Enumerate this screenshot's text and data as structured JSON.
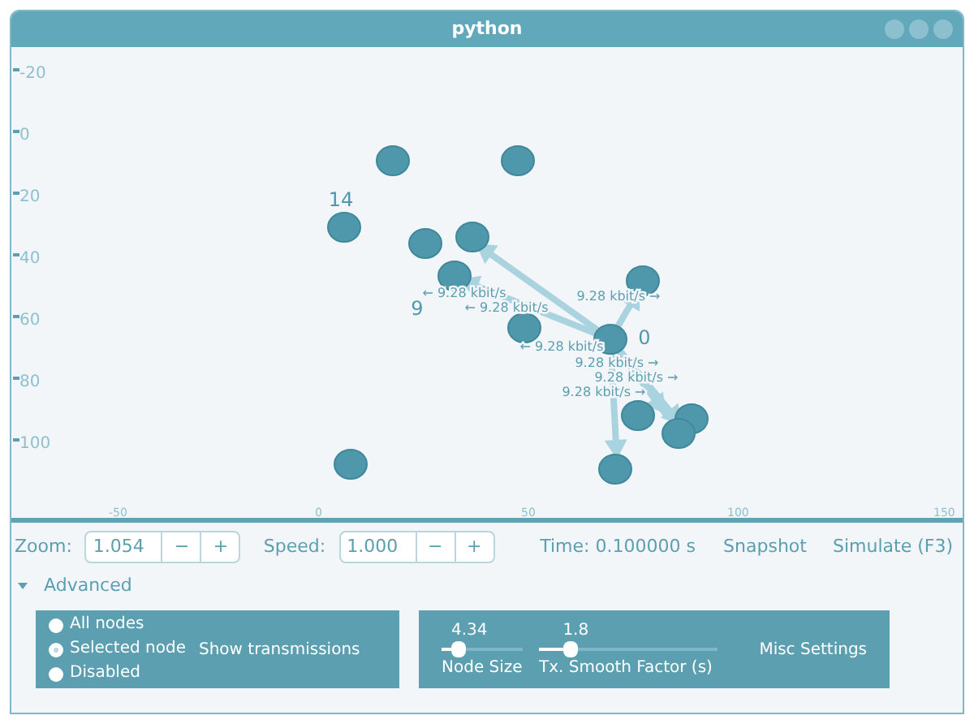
{
  "window": {
    "title": "python"
  },
  "canvas": {
    "y_ticks": [
      "-20",
      "0",
      "20",
      "40",
      "60",
      "80",
      "100"
    ],
    "x_ticks": [
      "-50",
      "0",
      "50",
      "100",
      "150"
    ],
    "nodes": [
      {
        "kind": "node"
      },
      {
        "kind": "node"
      },
      {
        "kind": "node",
        "label": "14"
      },
      {
        "kind": "node"
      },
      {
        "kind": "node"
      },
      {
        "kind": "node",
        "label": "9"
      },
      {
        "kind": "node"
      },
      {
        "kind": "node",
        "label": "0"
      },
      {
        "kind": "node"
      },
      {
        "kind": "node"
      },
      {
        "kind": "node"
      },
      {
        "kind": "node"
      },
      {
        "kind": "node"
      },
      {
        "kind": "node"
      }
    ],
    "transmissions": [
      {
        "text": "← 9.28 kbit/s"
      },
      {
        "text": "9.28 kbit/s →"
      },
      {
        "text": "← 9.28 kbit/s"
      },
      {
        "text": "← 9.28 kbit/s"
      },
      {
        "text": "9.28 kbit/s →"
      },
      {
        "text": "9.28 kbit/s →"
      },
      {
        "text": "9.28 kbit/s →"
      }
    ]
  },
  "toolbar": {
    "zoom": {
      "label": "Zoom:",
      "value": "1.054",
      "minus": "−",
      "plus": "+"
    },
    "speed": {
      "label": "Speed:",
      "value": "1.000",
      "minus": "−",
      "plus": "+"
    },
    "time": "Time: 0.100000 s",
    "buttons": [
      "Snapshot",
      "Simulate (F3)"
    ]
  },
  "advanced": {
    "label": "Advanced",
    "expanded": true,
    "transmissions": {
      "title": "Show transmissions",
      "options": [
        {
          "label": "All nodes",
          "selected": false
        },
        {
          "label": "Selected node",
          "selected": true
        },
        {
          "label": "Disabled",
          "selected": false
        }
      ]
    },
    "misc": {
      "title": "Misc Settings",
      "sliders": [
        {
          "name": "Node Size",
          "reading": "4.34",
          "level": 0.2
        },
        {
          "name": "Tx. Smooth Factor (s)",
          "reading": "1.8",
          "level": 0.17
        }
      ]
    }
  }
}
